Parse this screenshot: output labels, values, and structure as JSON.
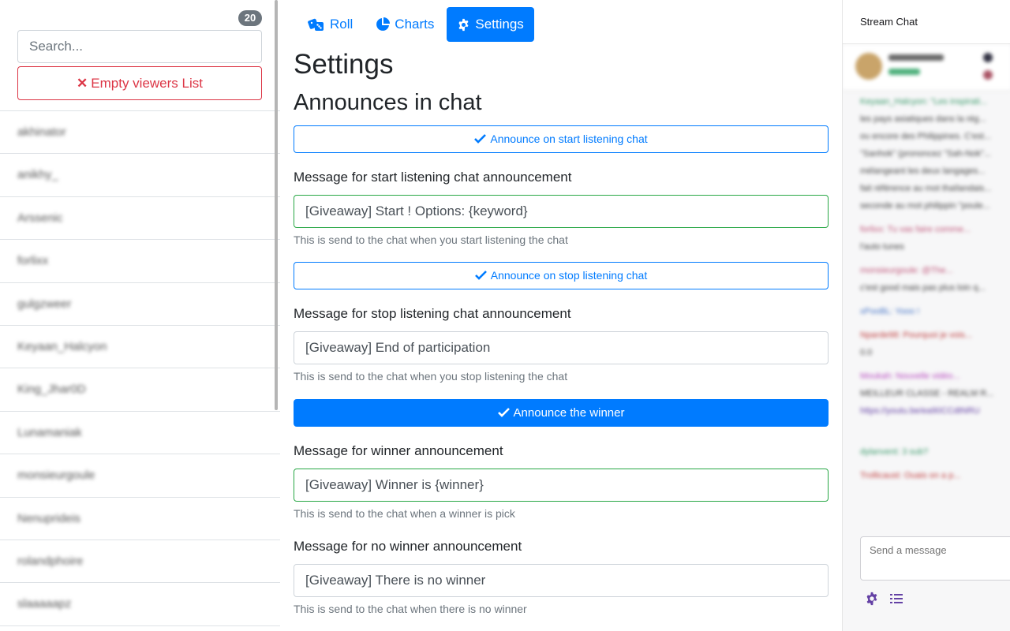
{
  "viewers": {
    "count": "20",
    "search_placeholder": "Search...",
    "empty_label": "Empty viewers List",
    "items": [
      "akhinator",
      "anikhy_",
      "Arssenic",
      "forlixx",
      "gulgzweer",
      "Keyaan_Halcyon",
      "King_Jhar0D",
      "Lunamaniak",
      "monsieurgoule",
      "Nenuprideis",
      "rolandphoire",
      "slaaaaapz"
    ]
  },
  "tabs": [
    {
      "label": "Roll",
      "icon": "dice-icon"
    },
    {
      "label": "Charts",
      "icon": "pie-chart-icon"
    },
    {
      "label": "Settings",
      "icon": "gear-icon",
      "active": true
    }
  ],
  "page": {
    "title": "Settings",
    "section": "Announces in chat"
  },
  "settings": {
    "start": {
      "toggle": "Announce on start listening chat",
      "label": "Message for start listening chat announcement",
      "value": "[Giveaway] Start ! Options: {keyword}",
      "help": "This is send to the chat when you start listening the chat"
    },
    "stop": {
      "toggle": "Announce on stop listening chat",
      "label": "Message for stop listening chat announcement",
      "value": "[Giveaway] End of participation",
      "help": "This is send to the chat when you stop listening the chat"
    },
    "winner": {
      "toggle": "Announce the winner",
      "label": "Message for winner announcement",
      "value": "[Giveaway] Winner is {winner}",
      "help": "This is send to the chat when a winner is pick"
    },
    "no_winner": {
      "label": "Message for no winner announcement",
      "value": "[Giveaway] There is no winner",
      "help": "This is send to the chat when there is no winner"
    }
  },
  "chat": {
    "title": "Stream Chat",
    "input_placeholder": "Send a message",
    "lines": [
      "Keyaan_Halcyon: \"Les inspirati...",
      "les pays asiatiques dans la rég...",
      "ou encore des Philippines. C'est...",
      "\"Sanhok\" (prononcez \"Sah-Nok\"...",
      "mélangeant les deux langages...",
      "fait référence au mot thaïlandais...",
      "seconde au mot philippin \"poule...",
      "forlixx: Tu vas faire comme...",
      "l'auto tunes",
      "monsieurgoule: @The...",
      "c'est good mais pas plus loin q...",
      "xPooBL: Yooo !",
      "Nparde98: Pourquoi je vois...",
      "0.0",
      "Moukah: Nouvelle vidéo...",
      "MEILLEUR CLASSE - REALM R...",
      "https://youtu.be/ea90CCdtNRU",
      "dylanvent: 3 sub?",
      "Trollicaust: Ouais on a p..."
    ]
  },
  "colors": {
    "primary": "#007bff",
    "danger": "#dc3545",
    "success": "#28a745",
    "chat_purple": "#6441a5"
  }
}
